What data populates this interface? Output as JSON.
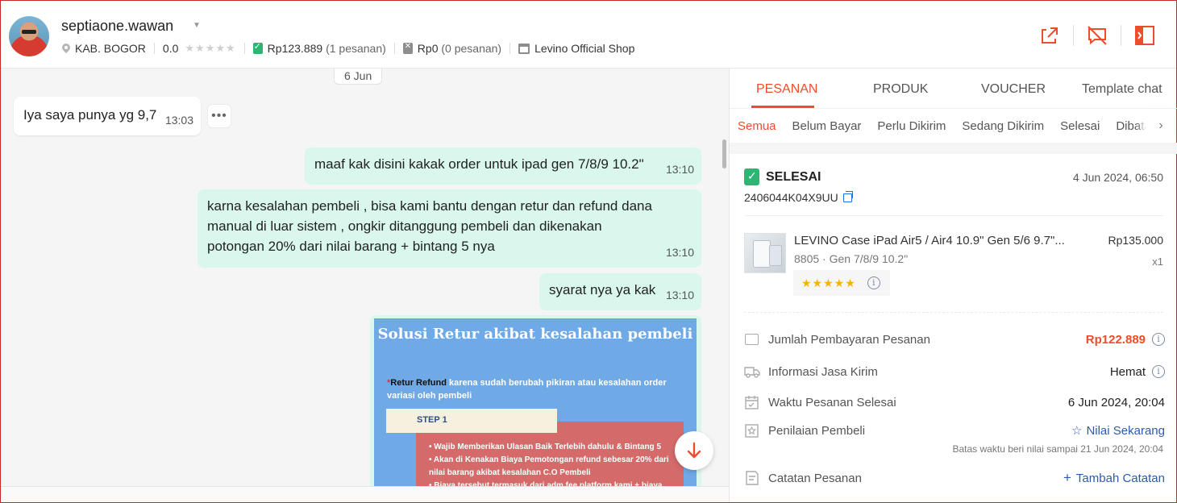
{
  "header": {
    "username": "septiaone.wawan",
    "location": "KAB. BOGOR",
    "rating": "0.0",
    "stars": "★★★★★",
    "paid_amount": "Rp123.889",
    "paid_count": "(1 pesanan)",
    "cancelled_amount": "Rp0",
    "cancelled_count": "(0 pesanan)",
    "shop": "Levino Official Shop"
  },
  "chat": {
    "date": "6 Jun",
    "messages": [
      {
        "text": "Iya saya punya yg 9,7",
        "time": "13:03"
      },
      {
        "text": "maaf kak disini kakak order untuk ipad gen 7/8/9 10.2\"",
        "time": "13:10"
      },
      {
        "text": "karna kesalahan pembeli , bisa kami bantu dengan retur dan refund dana manual di luar sistem , ongkir ditanggung pembeli dan dikenakan potongan 20% dari nilai barang + bintang 5 nya",
        "time": "13:10"
      },
      {
        "text": "syarat nya ya kak",
        "time": "13:10"
      }
    ],
    "more_glyph": "•••",
    "poster": {
      "title": "Solusi Retur akibat kesalahan pembeli",
      "asterisk": "*",
      "keyword": "Retur Refund",
      "text": " karena sudah berubah pikiran atau kesalahan order variasi oleh pembeli",
      "step": "STEP 1",
      "bullets": [
        "Wajib Memberikan Ulasan Baik Terlebih dahulu & Bintang 5",
        "Akan di Kenakan Biaya Pemotongan refund sebesar 20% dari nilai barang akibat kesalahan C.O Pembeli",
        "Biaya tersebut termasuk dari adm fee platform kami + biaya"
      ]
    }
  },
  "panel": {
    "tabs": [
      "PESANAN",
      "PRODUK",
      "VOUCHER",
      "Template chat"
    ],
    "subtabs": [
      "Semua",
      "Belum Bayar",
      "Perlu Dikirim",
      "Sedang Dikirim",
      "Selesai",
      "Dibatalkan"
    ],
    "subtab_arrow": "›",
    "order": {
      "status": "SELESAI",
      "date": "4 Jun 2024, 06:50",
      "id": "2406044K04X9UU",
      "product_name": "LEVINO Case iPad Air5 / Air4 10.9\" Gen 5/6 9.7\"...",
      "variant": "8805 · Gen 7/8/9 10.2\"",
      "price": "Rp135.000",
      "qty": "x1",
      "stars": "★★★★★"
    },
    "rows": {
      "payment_label": "Jumlah Pembayaran Pesanan",
      "payment_value": "Rp122.889",
      "shipping_label": "Informasi Jasa Kirim",
      "shipping_value": "Hemat",
      "completed_label": "Waktu Pesanan Selesai",
      "completed_value": "6 Jun 2024, 20:04",
      "review_label": "Penilaian Pembeli",
      "review_value": "Nilai Sekarang",
      "review_deadline": "Batas waktu beri nilai sampai 21 Jun 2024, 20:04",
      "notes_label": "Catatan Pesanan",
      "notes_value": "Tambah Catatan"
    },
    "info_glyph": "i"
  },
  "colors": {
    "accent": "#ee4d2d",
    "bubble_out": "#d9f7ec",
    "success": "#2bb673",
    "link": "#2e5aac"
  }
}
